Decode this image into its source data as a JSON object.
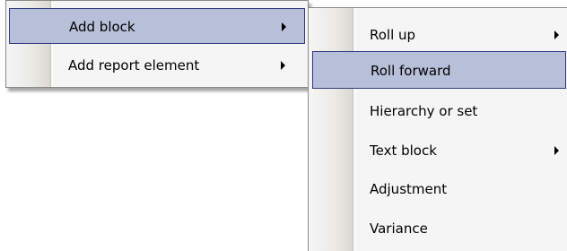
{
  "menu_main": {
    "items": [
      {
        "label": "Add block",
        "has_submenu": true,
        "highlighted": true
      },
      {
        "label": "Add report element",
        "has_submenu": true,
        "highlighted": false
      }
    ]
  },
  "submenu_add_block": {
    "items": [
      {
        "label": "Roll up",
        "has_submenu": true,
        "highlighted": false
      },
      {
        "label": "Roll forward",
        "has_submenu": false,
        "highlighted": true
      },
      {
        "label": "Hierarchy or set",
        "has_submenu": false,
        "highlighted": false
      },
      {
        "label": "Text block",
        "has_submenu": true,
        "highlighted": false
      },
      {
        "label": "Adjustment",
        "has_submenu": false,
        "highlighted": false
      },
      {
        "label": "Variance",
        "has_submenu": false,
        "highlighted": false
      }
    ]
  },
  "colors": {
    "menu_background": "#f5f5f5",
    "highlight_fill": "#b7bfd9",
    "highlight_border": "#2f3c7e",
    "menu_border": "#8a8a8a",
    "text": "#000000"
  },
  "icons": {
    "submenu_arrow": "submenu-arrow-icon"
  }
}
